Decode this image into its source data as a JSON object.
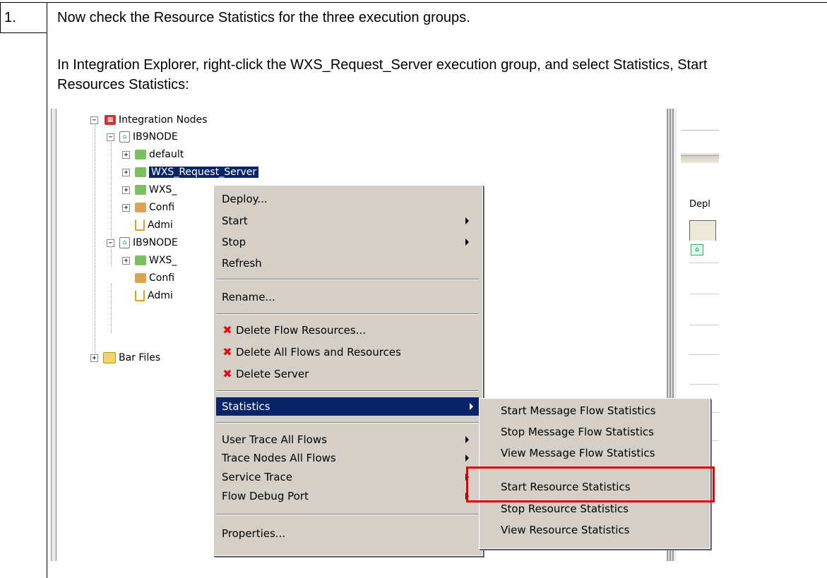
{
  "step": {
    "number": "1.",
    "intro": "Now check the Resource Statistics for the three execution groups.",
    "instruction": "In Integration Explorer, right-click the WXS_Request_Server execution group, and select Statistics, Start Resources Statistics:"
  },
  "tree": {
    "integration_nodes": "Integration Nodes",
    "node1": "IB9NODE",
    "default": "default",
    "wxs_request_server": "WXS_Request_Server",
    "wxs2": "WXS_",
    "config1": "Confi",
    "admin1": "Admi",
    "node2": "IB9NODE",
    "wxs3": "WXS_",
    "config2": "Confi",
    "admin2": "Admi",
    "bar_files": "Bar Files"
  },
  "right_panel": {
    "deploy_label": "Depl"
  },
  "context_menu": {
    "deploy": "Deploy...",
    "start": "Start",
    "stop": "Stop",
    "refresh": "Refresh",
    "rename": "Rename...",
    "delete_flow_resources": "Delete Flow Resources...",
    "delete_all": "Delete All Flows and Resources",
    "delete_server": "Delete Server",
    "statistics": "Statistics",
    "user_trace": "User Trace All Flows",
    "trace_nodes": "Trace Nodes All Flows",
    "service_trace": "Service Trace",
    "flow_debug_port": "Flow Debug Port",
    "properties": "Properties..."
  },
  "submenu": {
    "start_mf": "Start Message Flow Statistics",
    "stop_mf": "Stop Message Flow Statistics",
    "view_mf": "View Message Flow Statistics",
    "start_res": "Start Resource Statistics",
    "stop_res": "Stop Resource Statistics",
    "view_res": "View Resource Statistics"
  },
  "colors": {
    "highlight": "#0a246a",
    "menu_bg": "#d4d0c8",
    "callout": "#e00000"
  }
}
